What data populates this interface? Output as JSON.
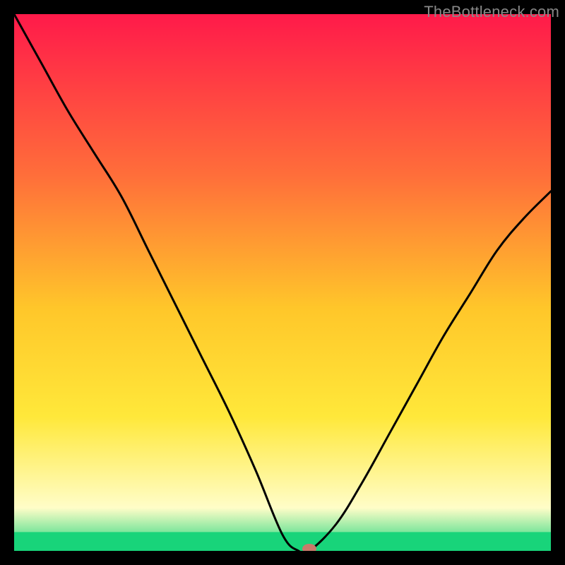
{
  "watermark": "TheBottleneck.com",
  "chart_data": {
    "type": "line",
    "title": "",
    "xlabel": "",
    "ylabel": "",
    "x": [
      0.0,
      0.05,
      0.1,
      0.15,
      0.2,
      0.25,
      0.3,
      0.35,
      0.4,
      0.45,
      0.5,
      0.53,
      0.55,
      0.6,
      0.65,
      0.7,
      0.75,
      0.8,
      0.85,
      0.9,
      0.95,
      1.0
    ],
    "values": [
      1.0,
      0.91,
      0.82,
      0.74,
      0.66,
      0.56,
      0.46,
      0.36,
      0.26,
      0.15,
      0.03,
      0.0,
      0.0,
      0.05,
      0.13,
      0.22,
      0.31,
      0.4,
      0.48,
      0.56,
      0.62,
      0.67
    ],
    "xlim": [
      0,
      1
    ],
    "ylim": [
      0,
      1
    ],
    "marker": {
      "x": 0.55,
      "y": 0.0
    },
    "bottom_band_fraction": 0.035
  },
  "colors": {
    "gradient_top": "#FF1A4A",
    "gradient_mid1": "#FF6E3A",
    "gradient_mid2": "#FFC72A",
    "gradient_mid3": "#FFE83A",
    "gradient_mid4": "#FFFDC8",
    "gradient_bottom": "#18D47A",
    "curve": "#000000",
    "marker": "#C97A6A",
    "frame": "#000000"
  }
}
